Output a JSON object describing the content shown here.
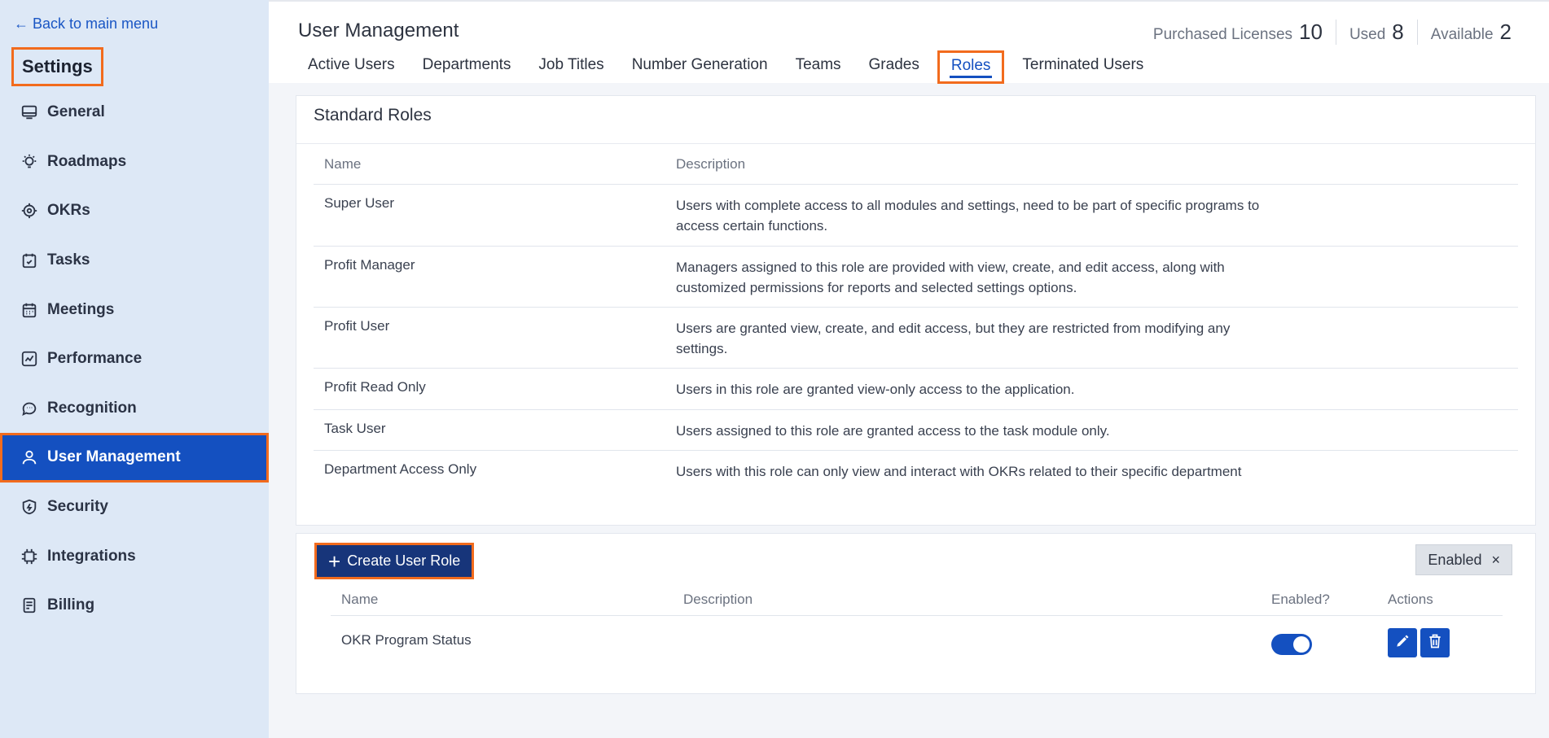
{
  "sidebar": {
    "back_label": "← Back to main menu",
    "title": "Settings",
    "items": [
      {
        "label": "General",
        "icon": "monitor-icon"
      },
      {
        "label": "Roadmaps",
        "icon": "lightbulb-icon"
      },
      {
        "label": "OKRs",
        "icon": "target-icon"
      },
      {
        "label": "Tasks",
        "icon": "calendar-check-icon"
      },
      {
        "label": "Meetings",
        "icon": "calendar-grid-icon"
      },
      {
        "label": "Performance",
        "icon": "chart-line-icon"
      },
      {
        "label": "Recognition",
        "icon": "chat-bubble-icon"
      },
      {
        "label": "User Management",
        "icon": "user-icon",
        "active": true
      },
      {
        "label": "Security",
        "icon": "shield-icon"
      },
      {
        "label": "Integrations",
        "icon": "chip-icon"
      },
      {
        "label": "Billing",
        "icon": "document-icon"
      }
    ]
  },
  "header": {
    "title": "User Management",
    "licenses": {
      "purchased_label": "Purchased Licenses",
      "purchased_value": "10",
      "used_label": "Used",
      "used_value": "8",
      "available_label": "Available",
      "available_value": "2"
    },
    "tabs": [
      {
        "label": "Active Users"
      },
      {
        "label": "Departments"
      },
      {
        "label": "Job Titles"
      },
      {
        "label": "Number Generation"
      },
      {
        "label": "Teams"
      },
      {
        "label": "Grades"
      },
      {
        "label": "Roles",
        "active": true
      },
      {
        "label": "Terminated Users"
      }
    ]
  },
  "standard_roles": {
    "title": "Standard Roles",
    "columns": {
      "name": "Name",
      "description": "Description"
    },
    "rows": [
      {
        "name": "Super User",
        "description": "Users with complete access to all modules and settings, need to be part of specific programs to access certain functions."
      },
      {
        "name": "Profit Manager",
        "description": "Managers assigned to this role are provided with view, create, and edit access, along with customized permissions for reports and selected settings options."
      },
      {
        "name": "Profit User",
        "description": "Users are granted view, create, and edit access, but they are restricted from modifying any settings."
      },
      {
        "name": "Profit Read Only",
        "description": "Users in this role are granted view-only access to the application."
      },
      {
        "name": "Task User",
        "description": "Users assigned to this role are granted access to the task module only."
      },
      {
        "name": "Department Access Only",
        "description": "Users with this role can only view and interact with OKRs related to their specific department"
      }
    ]
  },
  "custom_roles": {
    "create_label": "Create User Role",
    "filter_chip_label": "Enabled",
    "filter_chip_close": "×",
    "columns": {
      "name": "Name",
      "description": "Description",
      "enabled": "Enabled?",
      "actions": "Actions"
    },
    "rows": [
      {
        "name": "OKR Program Status",
        "description": "",
        "enabled": true
      }
    ]
  },
  "colors": {
    "accent": "#1450c0",
    "highlight": "#f26b1d",
    "sidebar_bg": "#dde8f6",
    "button_dark": "#17357a"
  }
}
